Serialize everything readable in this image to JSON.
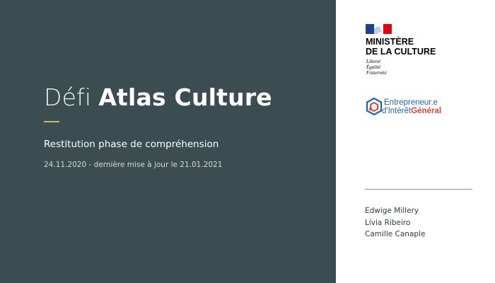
{
  "title": {
    "light": "Défi",
    "bold": "Atlas Culture"
  },
  "subtitle": "Restitution phase de compréhension",
  "dateline": "24.11.2020 - dernière mise à jour le 21.01.2021",
  "ministry": {
    "name_line1": "MINISTÈRE",
    "name_line2": "DE LA CULTURE",
    "motto": [
      "Liberté",
      "Égalité",
      "Fraternité"
    ]
  },
  "eig": {
    "line1": "Entrepreneur.e",
    "line2_part1": "d'Intérêt",
    "line2_part2": "Général"
  },
  "authors": [
    "Edwige Millery",
    "Lívia Ribeiro",
    "Camille Canaple"
  ],
  "colors": {
    "panel": "#3c4d51",
    "accent": "#d7b46a",
    "eig_blue": "#1e63b0",
    "eig_red": "#e2463d"
  }
}
